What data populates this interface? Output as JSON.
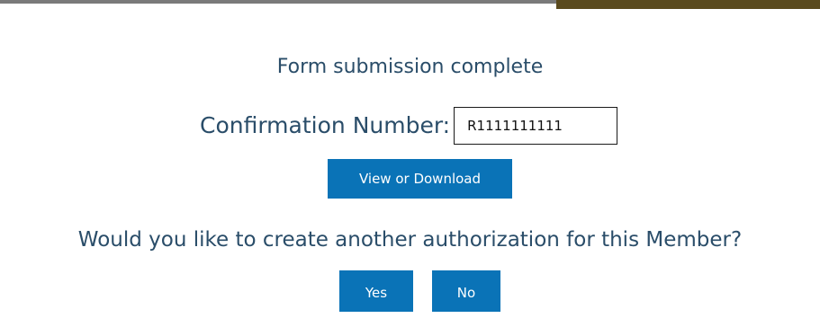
{
  "page": {
    "title": "Form submission complete",
    "confirmation_label": "Confirmation Number:",
    "confirmation_value": "R1111111111",
    "view_download_label": "View or Download",
    "question": "Would you like to create another authorization for this Member?",
    "yes_label": "Yes",
    "no_label": "No"
  },
  "colors": {
    "text": "#2a4d69",
    "button": "#0a73b7",
    "top_rule": "#7a7a7a",
    "top_accent": "#5a4a1e"
  }
}
